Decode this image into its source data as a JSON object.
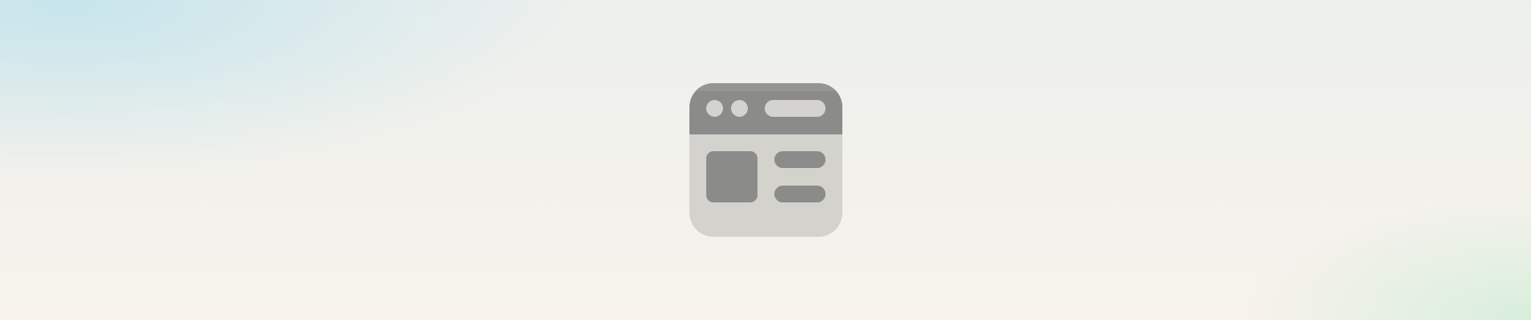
{
  "app_icon": {
    "icon": "browser-window-icon",
    "colors": {
      "frame_dark": "#8b8b8a",
      "frame_light": "#d3d2cd"
    }
  },
  "background": {
    "colors": {
      "base": "#f1f1ec",
      "top_left_tint": "#c4e4ec",
      "bottom_right_tint": "#d6eedb",
      "bottom_tint": "#f8f2ec"
    }
  }
}
